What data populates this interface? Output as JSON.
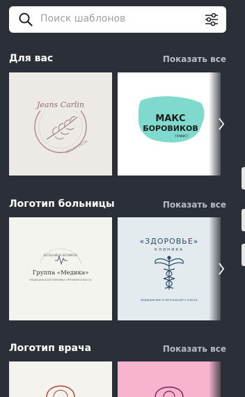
{
  "search": {
    "placeholder": "Поиск шаблонов"
  },
  "sections": [
    {
      "title": "Для вас",
      "show_all": "Показать все",
      "cards": [
        {
          "name": "Jeans Carlin",
          "sub": "BEAUTY SALON"
        },
        {
          "line1": "МАКС",
          "line2": "БОРОВИКОВ",
          "tag": "ГРАФИСТ"
        }
      ]
    },
    {
      "title": "Логотип больницы",
      "show_all": "Показать все",
      "cards": [
        {
          "arc": "БОЛЬНИЦА ВЕЛИКОЕ",
          "name": "Группа «Медика»",
          "sub": "МЕДИЦИНСКАЯ КЛИНИКА ПРЕМИУМ-КЛАССА"
        },
        {
          "name": "«ЗДОРОВЬЕ»",
          "sub": "КЛИНИКА",
          "tag": "МЕДИЦИНСКИЕ УСЛУГИ ВЫСШЕГО КЛАССА"
        }
      ]
    },
    {
      "title": "Логотип врача",
      "show_all": "Показать все"
    }
  ],
  "colors": {
    "background": "#2b3038",
    "teal": "#7fd9cc",
    "navy": "#2c4a6b"
  }
}
